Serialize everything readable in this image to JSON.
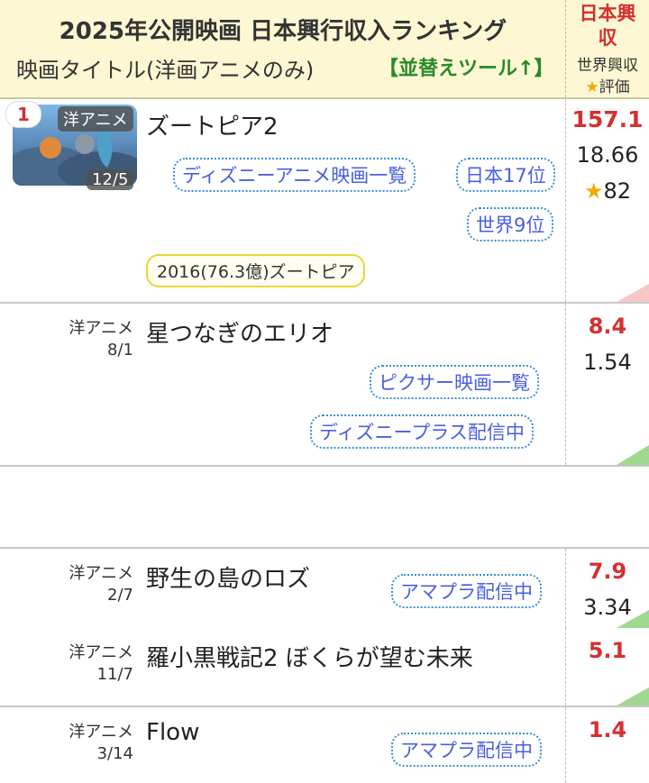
{
  "header": {
    "title": "2025年公開映画 日本興行収入ランキング",
    "subtitle": "映画タイトル(洋画アニメのみ)",
    "sort_tool": "【並替えツール↑】",
    "col_jp_line1": "日本興",
    "col_jp_line2": "収",
    "col_world": "世界興収",
    "col_rating_star": "★",
    "col_rating": "評価"
  },
  "colors": {
    "header_bg": "#fdf8d3",
    "jp_red": "#d43030",
    "link_blue": "#4a5fe0",
    "sort_green": "#2a8a2a",
    "corner_pink": "#f7c7c7",
    "corner_green": "#9fd88f"
  },
  "movies": [
    {
      "rank": "1",
      "genre": "洋アニメ",
      "date": "12/5",
      "title": "ズートピア2",
      "links": [
        "ディズニーアニメ映画一覧",
        "日本17位",
        "世界9位"
      ],
      "prev": "2016(76.3億)ズートピア",
      "jp_gross": "157.1",
      "world_gross": "18.66",
      "rating_star": "★",
      "rating": "82"
    },
    {
      "genre": "洋アニメ",
      "date": "8/1",
      "title": "星つなぎのエリオ",
      "links": [
        "ピクサー映画一覧",
        "ディズニープラス配信中"
      ],
      "jp_gross": "8.4",
      "world_gross": "1.54"
    },
    {
      "genre": "洋アニメ",
      "date": "2/7",
      "title": "野生の島のロズ",
      "links": [
        "アマプラ配信中"
      ],
      "jp_gross": "7.9",
      "world_gross": "3.34"
    },
    {
      "genre": "洋アニメ",
      "date": "11/7",
      "title": "羅小黒戦記2 ぼくらが望む未来",
      "jp_gross": "5.1"
    },
    {
      "genre": "洋アニメ",
      "date": "3/14",
      "title": "Flow",
      "links": [
        "アマプラ配信中"
      ],
      "jp_gross": "1.4"
    }
  ]
}
